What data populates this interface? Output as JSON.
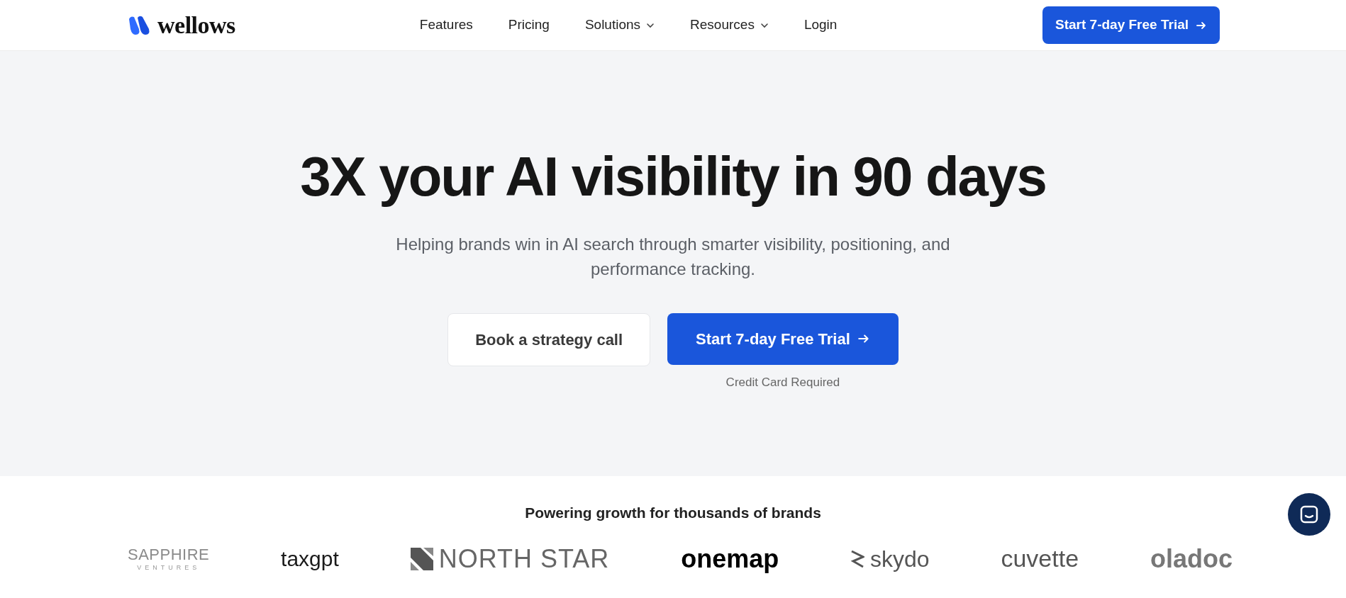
{
  "header": {
    "logo_text": "wellows",
    "nav": [
      {
        "label": "Features",
        "dropdown": false
      },
      {
        "label": "Pricing",
        "dropdown": false
      },
      {
        "label": "Solutions",
        "dropdown": true
      },
      {
        "label": "Resources",
        "dropdown": true
      },
      {
        "label": "Login",
        "dropdown": false
      }
    ],
    "cta": "Start 7-day Free Trial"
  },
  "hero": {
    "title": "3X your AI visibility in 90 days",
    "subtitle": "Helping brands win in AI search through smarter visibility, positioning, and performance tracking.",
    "secondary_button": "Book a strategy call",
    "primary_button": "Start 7-day Free Trial",
    "note": "Credit Card Required"
  },
  "brands": {
    "heading": "Powering growth for thousands of brands",
    "logos": [
      {
        "kind": "sapphire",
        "text": "SAPPHIRE",
        "subtext": "VENTURES"
      },
      {
        "kind": "taxgpt",
        "text": "taxgpt"
      },
      {
        "kind": "northstar",
        "text": "NORTH STAR"
      },
      {
        "kind": "onemap",
        "text": "onemap"
      },
      {
        "kind": "skydo",
        "text": "skydo"
      },
      {
        "kind": "cuvette",
        "text": "cuvette"
      },
      {
        "kind": "oladoc",
        "text": "oladoc"
      }
    ]
  }
}
